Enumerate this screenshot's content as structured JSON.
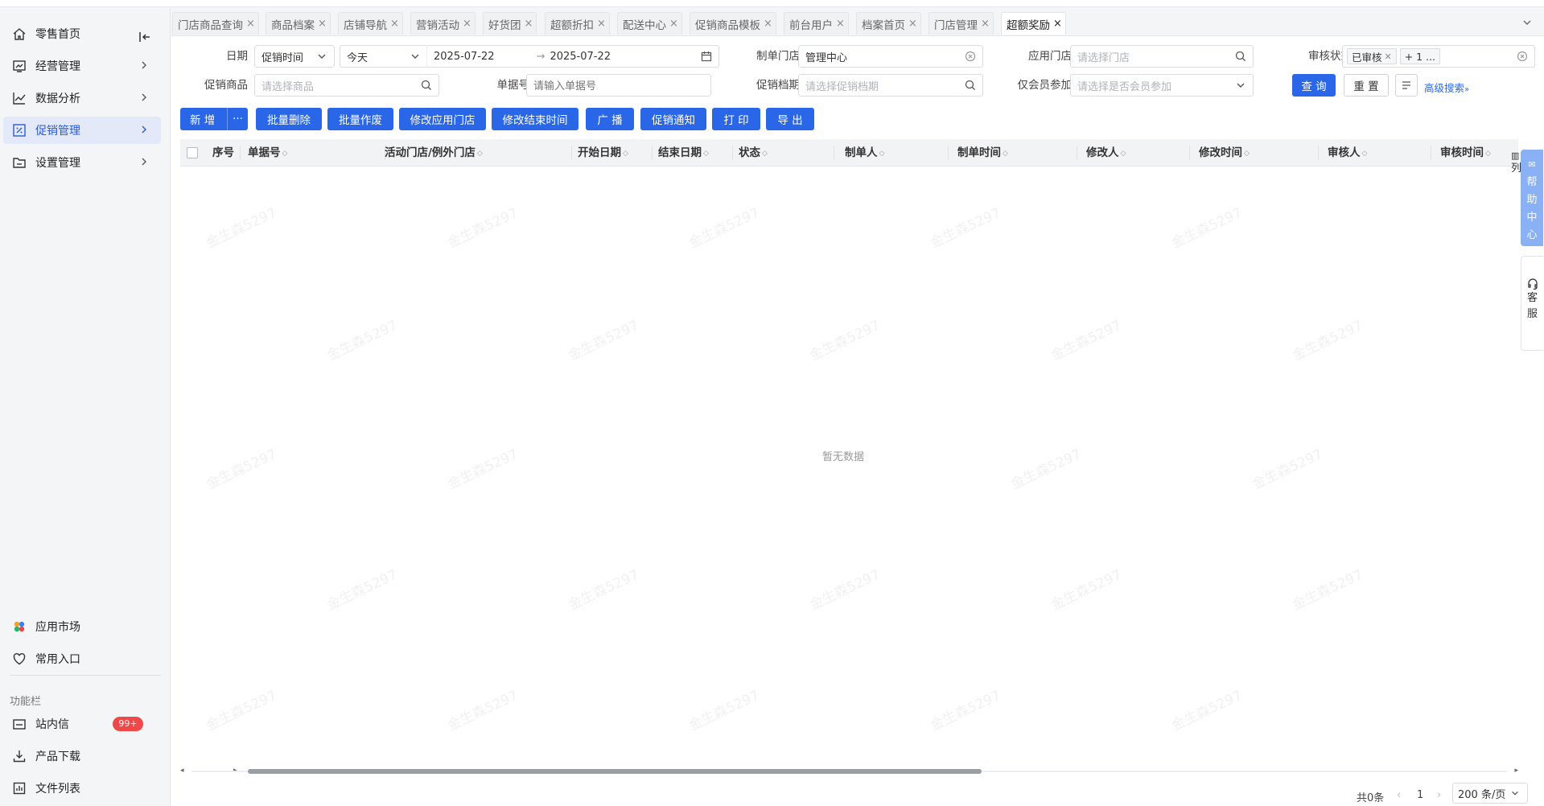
{
  "sidebar": {
    "items": [
      {
        "label": "零售首页",
        "icon": "home-icon"
      },
      {
        "label": "经营管理",
        "icon": "monitor-chart-icon"
      },
      {
        "label": "数据分析",
        "icon": "line-chart-icon"
      },
      {
        "label": "促销管理",
        "icon": "discount-icon"
      },
      {
        "label": "设置管理",
        "icon": "folder-icon"
      }
    ],
    "bottom_items": [
      {
        "label": "应用市场",
        "icon": "app-market-icon"
      },
      {
        "label": "常用入口",
        "icon": "heart-icon"
      }
    ],
    "section_label": "功能栏",
    "func_items": [
      {
        "label": "站内信",
        "icon": "mail-icon",
        "badge": "99+"
      },
      {
        "label": "产品下载",
        "icon": "download-icon"
      },
      {
        "label": "文件列表",
        "icon": "file-list-icon"
      }
    ]
  },
  "tabs": [
    {
      "label": "门店商品查询"
    },
    {
      "label": "商品档案"
    },
    {
      "label": "店铺导航"
    },
    {
      "label": "营销活动"
    },
    {
      "label": "好货团"
    },
    {
      "label": "超额折扣"
    },
    {
      "label": "配送中心"
    },
    {
      "label": "促销商品模板"
    },
    {
      "label": "前台用户"
    },
    {
      "label": "档案首页"
    },
    {
      "label": "门店管理"
    },
    {
      "label": "超额奖励"
    }
  ],
  "filters": {
    "date_label": "日期",
    "date_type": "促销时间",
    "date_range": "今天",
    "date_start": "2025-07-22",
    "date_sep": "→",
    "date_end": "2025-07-22",
    "maker_store_label": "制单门店",
    "maker_store_value": "管理中心",
    "apply_store_label": "应用门店",
    "apply_store_placeholder": "请选择门店",
    "audit_label": "审核状态",
    "audit_tag": "已审核",
    "audit_more": "+ 1 ...",
    "promo_goods_label": "促销商品",
    "promo_goods_placeholder": "请选择商品",
    "doc_no_label": "单据号",
    "doc_no_placeholder": "请输入单据号",
    "promo_period_label": "促销档期",
    "promo_period_placeholder": "请选择促销档期",
    "member_only_label": "仅会员参加",
    "member_only_placeholder": "请选择是否会员参加",
    "query_btn": "查 询",
    "reset_btn": "重 置",
    "advanced_link": "高级搜索"
  },
  "toolbar": {
    "add": "新 增",
    "more": "···",
    "batch_delete": "批量删除",
    "batch_void": "批量作废",
    "edit_store": "修改应用门店",
    "edit_end_time": "修改结束时间",
    "broadcast": "广 播",
    "promo_notice": "促销通知",
    "print": "打 印",
    "export": "导 出"
  },
  "table": {
    "columns": [
      "序号",
      "单据号",
      "活动门店/例外门店",
      "开始日期",
      "结束日期",
      "状态",
      "制单人",
      "制单时间",
      "修改人",
      "修改时间",
      "审核人",
      "审核时间"
    ],
    "empty_text": "暂无数据",
    "col_settings": "列"
  },
  "watermark_text": "金生森5297",
  "pagination": {
    "total": "共0条",
    "page": "1",
    "page_size": "200 条/页"
  },
  "float": {
    "help": [
      "帮",
      "助",
      "中",
      "心"
    ],
    "service": [
      "客",
      "服"
    ]
  },
  "colors": {
    "primary": "#2a66e8",
    "active_nav_bg": "#e3e9f8",
    "badge": "#f04848"
  }
}
